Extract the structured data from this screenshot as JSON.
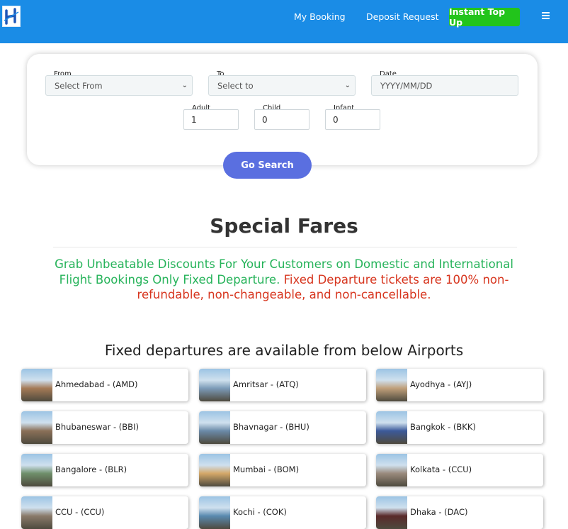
{
  "header": {
    "links": [
      "My Booking",
      "Deposit Request"
    ],
    "topup_label": "Instant Top Up"
  },
  "search": {
    "from_label": "From",
    "from_value": "Select From",
    "to_label": "To",
    "to_value": "Select to",
    "date_label": "Date",
    "date_placeholder": "YYYY/MM/DD",
    "adult_label": "Adult",
    "adult_value": "1",
    "child_label": "Child",
    "child_value": "0",
    "infant_label": "Infant",
    "infant_value": "0",
    "go_label": "Go Search"
  },
  "special": {
    "title": "Special Fares",
    "promo_green": "Grab Unbeatable Discounts For Your Customers on Domestic and International Flight Bookings Only Fixed Departure.",
    "promo_red": "Fixed Departure tickets are 100% non-refundable, non-changeable, and non-cancellable."
  },
  "airports": {
    "heading": "Fixed departures are available from below Airports",
    "items": [
      {
        "name": "Ahmedabad - (AMD)",
        "thumb": "#a57a56"
      },
      {
        "name": "Amritsar - (ATQ)",
        "thumb": "#7c9bb8"
      },
      {
        "name": "Ayodhya - (AYJ)",
        "thumb": "#c0a07a"
      },
      {
        "name": "Bhubaneswar - (BBI)",
        "thumb": "#8a7058"
      },
      {
        "name": "Bhavnagar - (BHU)",
        "thumb": "#6b8aa8"
      },
      {
        "name": "Bangkok - (BKK)",
        "thumb": "#3c5a9a"
      },
      {
        "name": "Bangalore - (BLR)",
        "thumb": "#6f8f6a"
      },
      {
        "name": "Mumbai - (BOM)",
        "thumb": "#d4a868"
      },
      {
        "name": "Kolkata - (CCU)",
        "thumb": "#9a8a7c"
      },
      {
        "name": "CCU - (CCU)",
        "thumb": "#8a7a6a"
      },
      {
        "name": "Kochi - (COK)",
        "thumb": "#5a8ab0"
      },
      {
        "name": "Dhaka - (DAC)",
        "thumb": "#5a2a2a"
      }
    ]
  }
}
